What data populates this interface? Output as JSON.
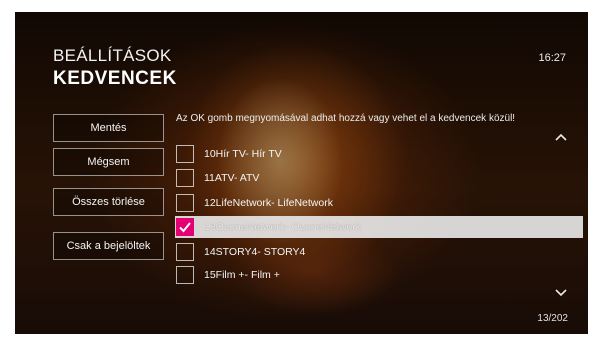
{
  "header": {
    "title_small": "BEÁLLÍTÁSOK",
    "title_big": "KEDVENCEK",
    "clock": "16:27"
  },
  "buttons": {
    "save": "Mentés",
    "cancel": "Mégsem",
    "clear_all": "Összes törlése",
    "only_selected": "Csak a bejelöltek"
  },
  "hint": "Az OK gomb megnyomásával adhat hozzá vagy vehet el a kedvencek közül!",
  "channels": [
    {
      "label": "10Hír TV- Hír TV",
      "checked": false,
      "highlighted": false
    },
    {
      "label": "11ATV- ATV",
      "checked": false,
      "highlighted": false
    },
    {
      "label": "12LifeNetwork- LifeNetwork",
      "checked": false,
      "highlighted": false
    },
    {
      "label": "13OzoneNetwork- OzoneNetwork",
      "checked": true,
      "highlighted": true
    },
    {
      "label": "14STORY4- STORY4",
      "checked": false,
      "highlighted": false
    },
    {
      "label": "15Film +- Film +",
      "checked": false,
      "highlighted": false
    }
  ],
  "pager": "13/202",
  "icons": {
    "up": "chevron-up-icon",
    "down": "chevron-down-icon",
    "check": "checkmark-icon"
  },
  "colors": {
    "accent": "#e20074",
    "selection": "#e6e6e6"
  }
}
